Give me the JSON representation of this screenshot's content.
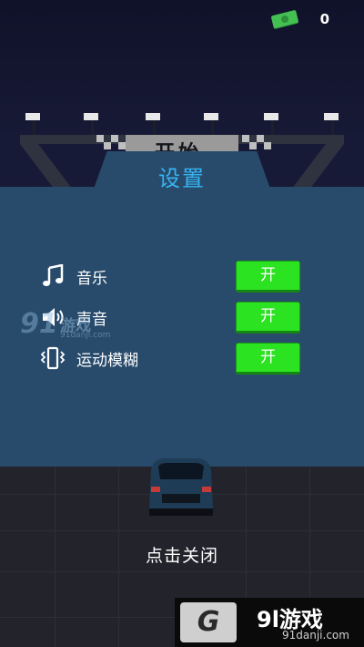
{
  "hud": {
    "money_value": "0",
    "money_icon": "cash-icon",
    "colors": {
      "money_green": "#3fbf4a"
    }
  },
  "background": {
    "gate_label": "开始"
  },
  "settings": {
    "title": "设置",
    "rows": [
      {
        "icon": "music-note-icon",
        "label": "音乐",
        "toggle": "开"
      },
      {
        "icon": "speaker-icon",
        "label": "声音",
        "toggle": "开"
      },
      {
        "icon": "vibration-icon",
        "label": "运动模糊",
        "toggle": "开"
      }
    ],
    "colors": {
      "panel_bg": "#284b6c",
      "title": "#36b4f2",
      "toggle_on": "#2be321"
    }
  },
  "footer": {
    "close_label": "点击关闭"
  },
  "watermark": {
    "left_number": "91",
    "left_brand": "游戏",
    "left_url": "91danji.com",
    "bottom_logo": "G",
    "bottom_brand": "9l游戏",
    "bottom_url": "91danji.com"
  }
}
